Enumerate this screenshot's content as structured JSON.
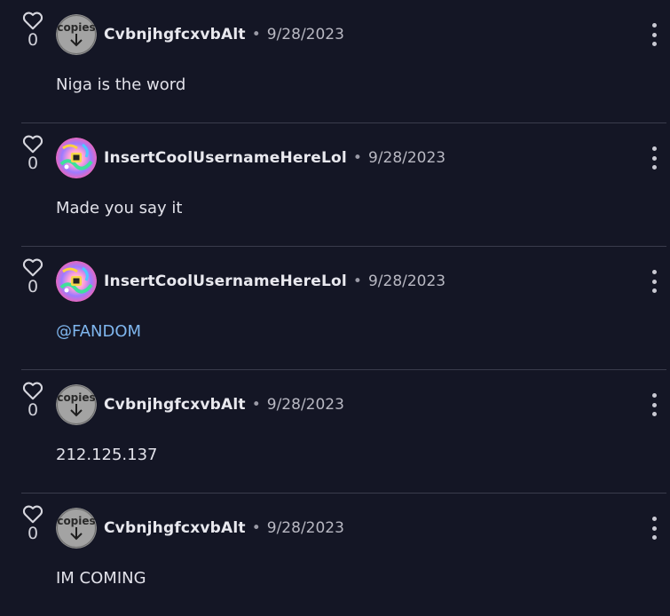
{
  "comments": [
    {
      "likes": "0",
      "avatar": "copies-avatar",
      "avatar_text": "copies",
      "username": "CvbnjhgfcxvbAlt",
      "date": "9/28/2023",
      "text": "Niga is the word",
      "is_mention": false
    },
    {
      "likes": "0",
      "avatar": "rainbow-avatar",
      "username": "InsertCoolUsernameHereLol",
      "date": "9/28/2023",
      "text": "Made you say it",
      "is_mention": false
    },
    {
      "likes": "0",
      "avatar": "rainbow-avatar",
      "username": "InsertCoolUsernameHereLol",
      "date": "9/28/2023",
      "text": "@FANDOM",
      "is_mention": true
    },
    {
      "likes": "0",
      "avatar": "copies-avatar",
      "avatar_text": "copies",
      "username": "CvbnjhgfcxvbAlt",
      "date": "9/28/2023",
      "text": "212.125.137",
      "is_mention": false
    },
    {
      "likes": "0",
      "avatar": "copies-avatar",
      "avatar_text": "copies",
      "username": "CvbnjhgfcxvbAlt",
      "date": "9/28/2023",
      "text": "IM COMING",
      "is_mention": false
    }
  ],
  "separator": "•",
  "colors": {
    "background": "#141625",
    "divider": "#3a3c4c",
    "mention": "#7fb6ee"
  },
  "icons": {
    "like": "heart-icon",
    "menu": "kebab-menu-icon"
  }
}
